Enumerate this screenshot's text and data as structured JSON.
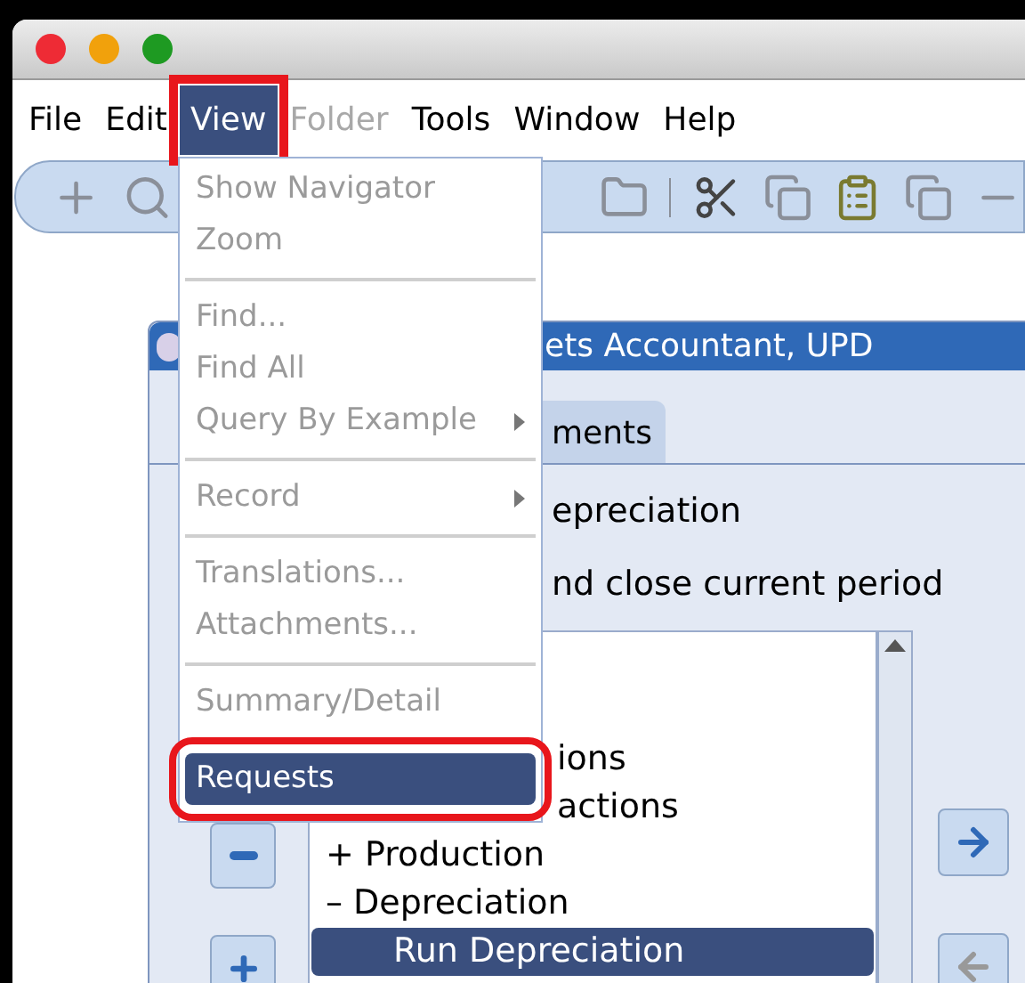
{
  "menubar": [
    {
      "label": "File",
      "selected": false,
      "disabled": false,
      "annotated": false
    },
    {
      "label": "Edit",
      "selected": false,
      "disabled": false,
      "annotated": false
    },
    {
      "label": "View",
      "selected": true,
      "disabled": false,
      "annotated": true
    },
    {
      "label": "Folder",
      "selected": false,
      "disabled": true,
      "annotated": false
    },
    {
      "label": "Tools",
      "selected": false,
      "disabled": false,
      "annotated": false
    },
    {
      "label": "Window",
      "selected": false,
      "disabled": false,
      "annotated": false
    },
    {
      "label": "Help",
      "selected": false,
      "disabled": false,
      "annotated": false
    }
  ],
  "view_menu": [
    {
      "kind": "item",
      "label": "Show Navigator",
      "disabled": true,
      "submenu": false,
      "selected": false,
      "annotated": false
    },
    {
      "kind": "item",
      "label": "Zoom",
      "disabled": true,
      "submenu": false,
      "selected": false,
      "annotated": false
    },
    {
      "kind": "separator"
    },
    {
      "kind": "item",
      "label": "Find...",
      "disabled": true,
      "submenu": false,
      "selected": false,
      "annotated": false
    },
    {
      "kind": "item",
      "label": "Find All",
      "disabled": true,
      "submenu": false,
      "selected": false,
      "annotated": false
    },
    {
      "kind": "item",
      "label": "Query By Example",
      "disabled": true,
      "submenu": true,
      "selected": false,
      "annotated": false
    },
    {
      "kind": "separator"
    },
    {
      "kind": "item",
      "label": "Record",
      "disabled": true,
      "submenu": true,
      "selected": false,
      "annotated": false
    },
    {
      "kind": "separator"
    },
    {
      "kind": "item",
      "label": "Translations...",
      "disabled": true,
      "submenu": false,
      "selected": false,
      "annotated": false
    },
    {
      "kind": "item",
      "label": "Attachments...",
      "disabled": true,
      "submenu": false,
      "selected": false,
      "annotated": false
    },
    {
      "kind": "separator"
    },
    {
      "kind": "item",
      "label": "Summary/Detail",
      "disabled": true,
      "submenu": false,
      "selected": false,
      "annotated": false
    },
    {
      "kind": "item",
      "label": "Requests",
      "disabled": false,
      "submenu": false,
      "selected": true,
      "annotated": true
    }
  ],
  "form_window": {
    "title": "ets Accountant, UPD",
    "tab": "ments",
    "lines": [
      "epreciation",
      "nd close current period"
    ],
    "tree": [
      {
        "kind": "cut",
        "label": "ions",
        "selected": false
      },
      {
        "kind": "cut",
        "label": "actions",
        "selected": false
      },
      {
        "kind": "node",
        "expander": "+",
        "label": "Production",
        "selected": false
      },
      {
        "kind": "node",
        "expander": "–",
        "label": "Depreciation",
        "selected": false,
        "children": [
          {
            "label": "Run Depreciation",
            "selected": true
          }
        ]
      }
    ]
  }
}
